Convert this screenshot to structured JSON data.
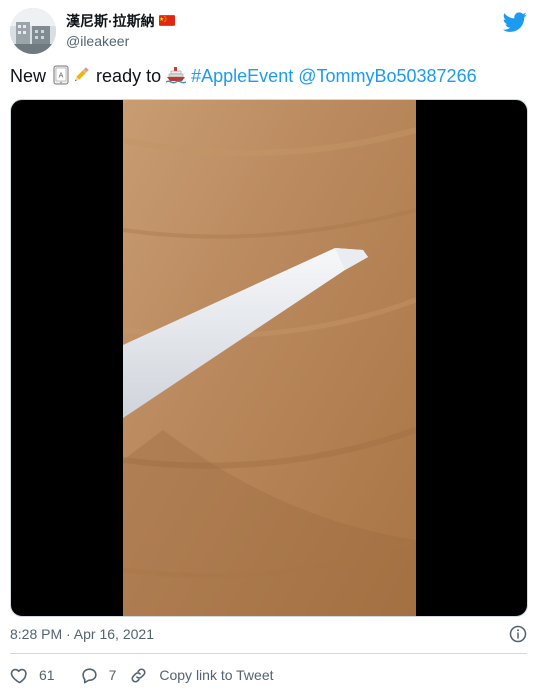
{
  "author": {
    "display_name": "漢尼斯·拉斯納",
    "handle": "@ileakeer",
    "flag_icon": "china-flag-icon"
  },
  "tweet": {
    "text_new": "New",
    "text_ready": "ready to",
    "hashtag": "#AppleEvent",
    "mention": "@TommyBo50387266",
    "emojis": [
      "ipad-emoji-icon",
      "pencil-emoji-icon",
      "ship-emoji-icon"
    ]
  },
  "media": {
    "type": "video"
  },
  "meta": {
    "timestamp": "8:28 PM · Apr 16, 2021"
  },
  "actions": {
    "like_count": "61",
    "reply_count": "7",
    "copy_link_label": "Copy link to Tweet"
  },
  "colors": {
    "link": "#1d9bf0",
    "secondary_text": "#536471",
    "twitter_blue": "#1d9bf0",
    "divider": "#cfd9de"
  }
}
